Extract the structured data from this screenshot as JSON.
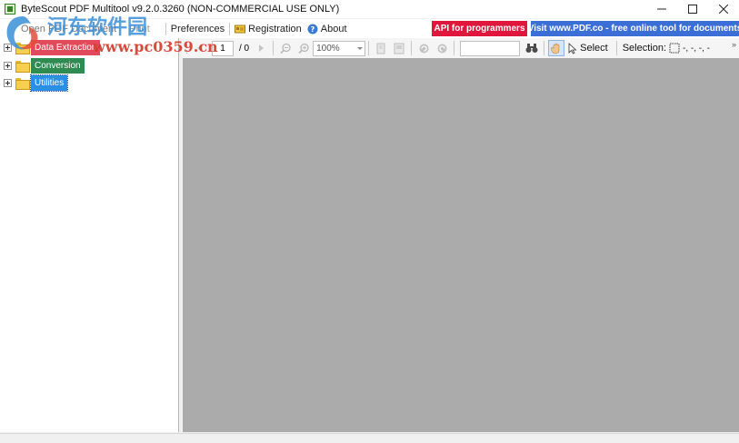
{
  "window": {
    "title": "ByteScout PDF Multitool v9.2.0.3260 (NON-COMMERCIAL USE ONLY)",
    "minimize_icon": "minimize-icon",
    "maximize_icon": "maximize-icon",
    "close_icon": "close-icon"
  },
  "menu": {
    "open_pdf": "Open PDF Document",
    "print": "Print",
    "preferences": "Preferences",
    "registration": "Registration",
    "about": "About",
    "api_button": "API for programmers",
    "visit_button": "Visit www.PDF.co - free online tool for documents"
  },
  "watermark": {
    "cn_text": "河东软件园",
    "url": "www.pc0359.cn"
  },
  "tree": {
    "items": [
      {
        "label": "Data Extraction",
        "color": "#e04a5a"
      },
      {
        "label": "Conversion",
        "color": "#2e8b52"
      },
      {
        "label": "Utilities",
        "color": "#2b8fe6"
      }
    ]
  },
  "toolbar": {
    "page_current": "1",
    "page_total": "/ 0",
    "zoom_value": "100%",
    "search_value": "",
    "select_label": "Select",
    "selection_label": "Selection:",
    "selection_coords": "-, -, -, -",
    "more": "»"
  },
  "colors": {
    "api_red": "#e1163c",
    "visit_blue": "#3b6fd6",
    "doc_background": "#ababab"
  }
}
